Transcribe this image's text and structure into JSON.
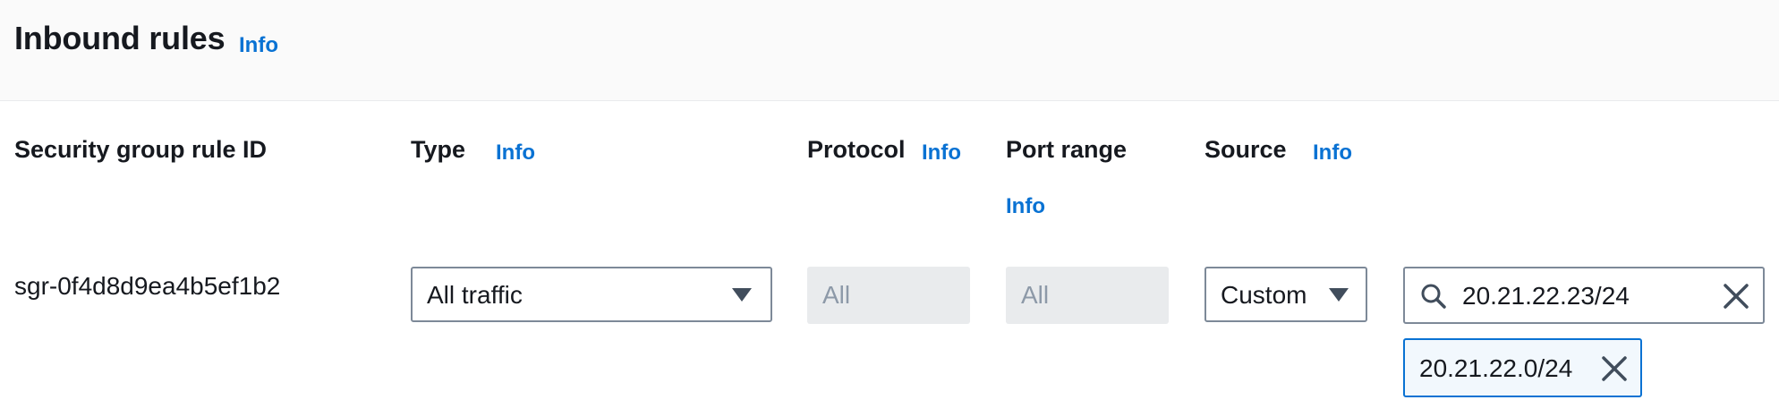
{
  "section": {
    "title": "Inbound rules",
    "info_label": "Info"
  },
  "columns": {
    "rule_id": "Security group rule ID",
    "type": "Type",
    "type_info": "Info",
    "protocol": "Protocol",
    "protocol_info": "Info",
    "port_range": "Port range",
    "port_range_info": "Info",
    "source": "Source",
    "source_info": "Info"
  },
  "rule": {
    "id": "sgr-0f4d8d9ea4b5ef1b2",
    "type": "All traffic",
    "protocol": "All",
    "port_range": "All",
    "source_type": "Custom",
    "source_search_value": "20.21.22.23/24",
    "source_tokens": [
      "20.21.22.0/24"
    ]
  },
  "icons": {
    "type_dropdown": "caret-down-icon",
    "source_dropdown": "caret-down-icon",
    "search": "search-icon",
    "clear": "close-icon",
    "token_dismiss": "close-icon"
  },
  "colors": {
    "link": "#0972d3",
    "header_bg": "#fafafa",
    "disabled_bg": "#e9ebed",
    "token_bg": "#f2f8fd",
    "token_border": "#0972d3"
  }
}
